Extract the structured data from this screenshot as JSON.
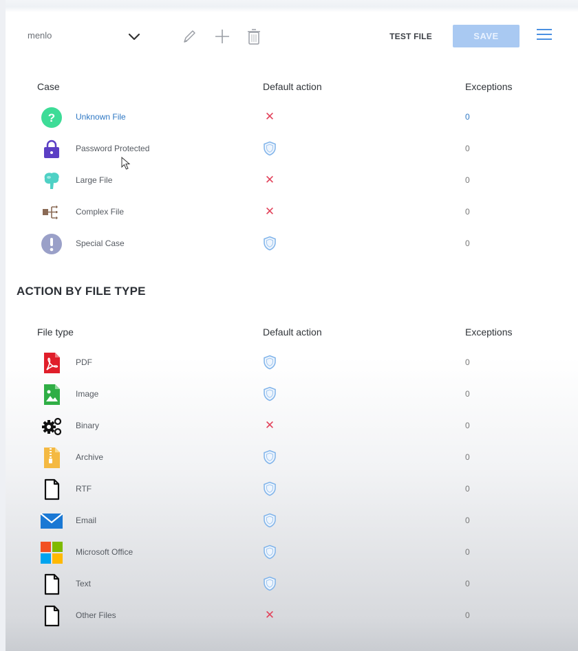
{
  "toolbar": {
    "profile_name": "menlo",
    "test_file_label": "TEST FILE",
    "save_label": "SAVE",
    "icons": [
      "chevron-down-icon",
      "pencil-icon",
      "plus-icon",
      "trash-icon",
      "hamburger-menu-icon"
    ],
    "accent_color": "#4a90e2",
    "save_bg_color": "#a9c9f2"
  },
  "cases_table": {
    "headers": {
      "case": "Case",
      "default_action": "Default action",
      "exceptions": "Exceptions"
    },
    "rows": [
      {
        "name": "Unknown File",
        "icon": "question-circle-icon",
        "action": "block",
        "exceptions": "0"
      },
      {
        "name": "Password Protected",
        "icon": "lock-icon",
        "action": "shield",
        "exceptions": "0"
      },
      {
        "name": "Large File",
        "icon": "large-file-icon",
        "action": "block",
        "exceptions": "0"
      },
      {
        "name": "Complex File",
        "icon": "complex-file-icon",
        "action": "block",
        "exceptions": "0"
      },
      {
        "name": "Special Case",
        "icon": "exclamation-circle-icon",
        "action": "shield",
        "exceptions": "0"
      }
    ]
  },
  "file_type_section": {
    "title": "ACTION BY FILE TYPE",
    "headers": {
      "file_type": "File type",
      "default_action": "Default action",
      "exceptions": "Exceptions"
    },
    "rows": [
      {
        "name": "PDF",
        "icon": "pdf-icon",
        "action": "shield",
        "exceptions": "0"
      },
      {
        "name": "Image",
        "icon": "image-file-icon",
        "action": "shield",
        "exceptions": "0"
      },
      {
        "name": "Binary",
        "icon": "gears-icon",
        "action": "block",
        "exceptions": "0"
      },
      {
        "name": "Archive",
        "icon": "zip-archive-icon",
        "action": "shield",
        "exceptions": "0"
      },
      {
        "name": "RTF",
        "icon": "document-icon",
        "action": "shield",
        "exceptions": "0"
      },
      {
        "name": "Email",
        "icon": "envelope-icon",
        "action": "shield",
        "exceptions": "0"
      },
      {
        "name": "Microsoft Office",
        "icon": "microsoft-office-icon",
        "action": "shield",
        "exceptions": "0"
      },
      {
        "name": "Text",
        "icon": "document-icon",
        "action": "shield",
        "exceptions": "0"
      },
      {
        "name": "Other Files",
        "icon": "document-icon",
        "action": "block",
        "exceptions": "0"
      }
    ]
  },
  "colors": {
    "block": "#e2445c",
    "shield": "#7fb3ea",
    "link": "#2f78c4"
  }
}
